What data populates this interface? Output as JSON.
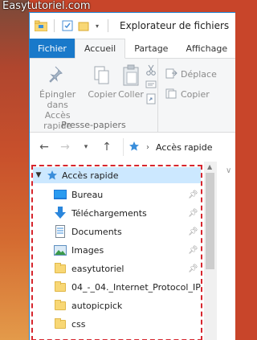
{
  "watermark": "Easytutoriel.com",
  "window": {
    "title": "Explorateur de fichiers"
  },
  "tabs": [
    {
      "label": "Fichier"
    },
    {
      "label": "Accueil"
    },
    {
      "label": "Partage"
    },
    {
      "label": "Affichage"
    }
  ],
  "ribbon": {
    "pin_label_1": "Épingler dans",
    "pin_label_2": "Accès rapide",
    "copy_label": "Copier",
    "paste_label": "Coller",
    "group_label": "Presse-papiers",
    "move_label": "Déplace",
    "copyto_label": "Copier"
  },
  "address": {
    "path": "Accès rapide"
  },
  "navpane": {
    "quick_access": "Accès rapide",
    "items": [
      {
        "label": "Bureau",
        "icon": "desktop-icon",
        "pinned": true
      },
      {
        "label": "Téléchargements",
        "icon": "download-arrow-icon",
        "pinned": true
      },
      {
        "label": "Documents",
        "icon": "document-icon",
        "pinned": true
      },
      {
        "label": "Images",
        "icon": "pictures-icon",
        "pinned": true
      },
      {
        "label": "easytutoriel",
        "icon": "folder-icon",
        "pinned": true
      },
      {
        "label": "04_-_04._Internet_Protocol_IP",
        "icon": "folder-icon",
        "pinned": false
      },
      {
        "label": "autopicpick",
        "icon": "folder-icon",
        "pinned": false
      },
      {
        "label": "css",
        "icon": "folder-icon",
        "pinned": false
      }
    ]
  },
  "colors": {
    "file_tab": "#1979ca",
    "selection": "#cce8ff",
    "highlight_border": "#d7262e"
  }
}
